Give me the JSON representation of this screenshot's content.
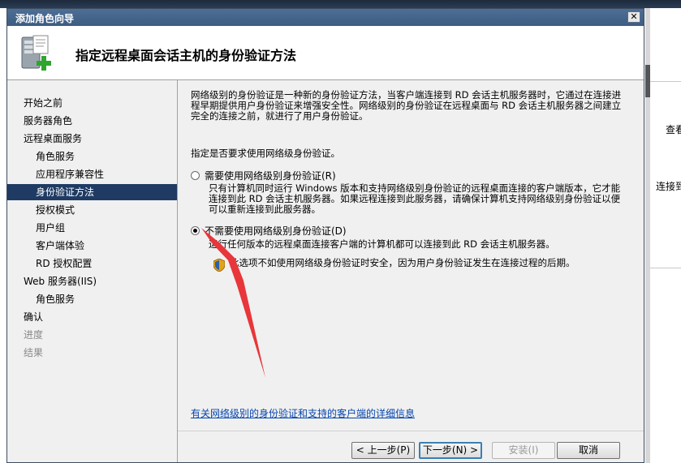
{
  "background": {
    "right_text_1": "查看",
    "right_text_2": "连接到"
  },
  "dialog": {
    "title": "添加角色向导",
    "close_label": "✕",
    "header_title": "指定远程桌面会话主机的身份验证方法"
  },
  "nav": {
    "items": [
      {
        "label": "开始之前",
        "level": 1,
        "state": "normal"
      },
      {
        "label": "服务器角色",
        "level": 1,
        "state": "normal"
      },
      {
        "label": "远程桌面服务",
        "level": 1,
        "state": "normal"
      },
      {
        "label": "角色服务",
        "level": 2,
        "state": "normal"
      },
      {
        "label": "应用程序兼容性",
        "level": 2,
        "state": "normal"
      },
      {
        "label": "身份验证方法",
        "level": 2,
        "state": "selected"
      },
      {
        "label": "授权模式",
        "level": 2,
        "state": "normal"
      },
      {
        "label": "用户组",
        "level": 2,
        "state": "normal"
      },
      {
        "label": "客户端体验",
        "level": 2,
        "state": "normal"
      },
      {
        "label": "RD 授权配置",
        "level": 2,
        "state": "normal"
      },
      {
        "label": "Web 服务器(IIS)",
        "level": 1,
        "state": "normal"
      },
      {
        "label": "角色服务",
        "level": 2,
        "state": "normal"
      },
      {
        "label": "确认",
        "level": 1,
        "state": "normal"
      },
      {
        "label": "进度",
        "level": 1,
        "state": "disabled"
      },
      {
        "label": "结果",
        "level": 1,
        "state": "disabled"
      }
    ]
  },
  "content": {
    "intro": "网络级别的身份验证是一种新的身份验证方法，当客户端连接到 RD 会话主机服务器时，它通过在连接进程早期提供用户身份验证来增强安全性。网络级别的身份验证在远程桌面与 RD 会话主机服务器之间建立完全的连接之前，就进行了用户身份验证。",
    "question": "指定是否要求使用网络级身份验证。",
    "option1_label": "需要使用网络级别身份验证(R)",
    "option1_desc": "只有计算机同时运行 Windows 版本和支持网络级别身份验证的远程桌面连接的客户端版本，它才能连接到此 RD 会话主机服务器。如果远程连接到此服务器，请确保计算机支持网络级别身份验证以便可以重新连接到此服务器。",
    "option2_label": "不需要使用网络级别身份验证(D)",
    "option2_desc": "运行任何版本的远程桌面连接客户端的计算机都可以连接到此 RD 会话主机服务器。",
    "warning": "此选项不如使用网络级身份验证时安全，因为用户身份验证发生在连接过程的后期。",
    "selected_option": 2,
    "more_info_link": "有关网络级别的身份验证和支持的客户端的详细信息"
  },
  "buttons": {
    "prev": "< 上一步(P)",
    "next": "下一步(N) >",
    "install": "安装(I)",
    "cancel": "取消"
  },
  "colors": {
    "nav_selected": "#1f3b63",
    "title_bar": "#4d6e95",
    "link": "#0645ad",
    "annotation_arrow": "#e8363a"
  }
}
